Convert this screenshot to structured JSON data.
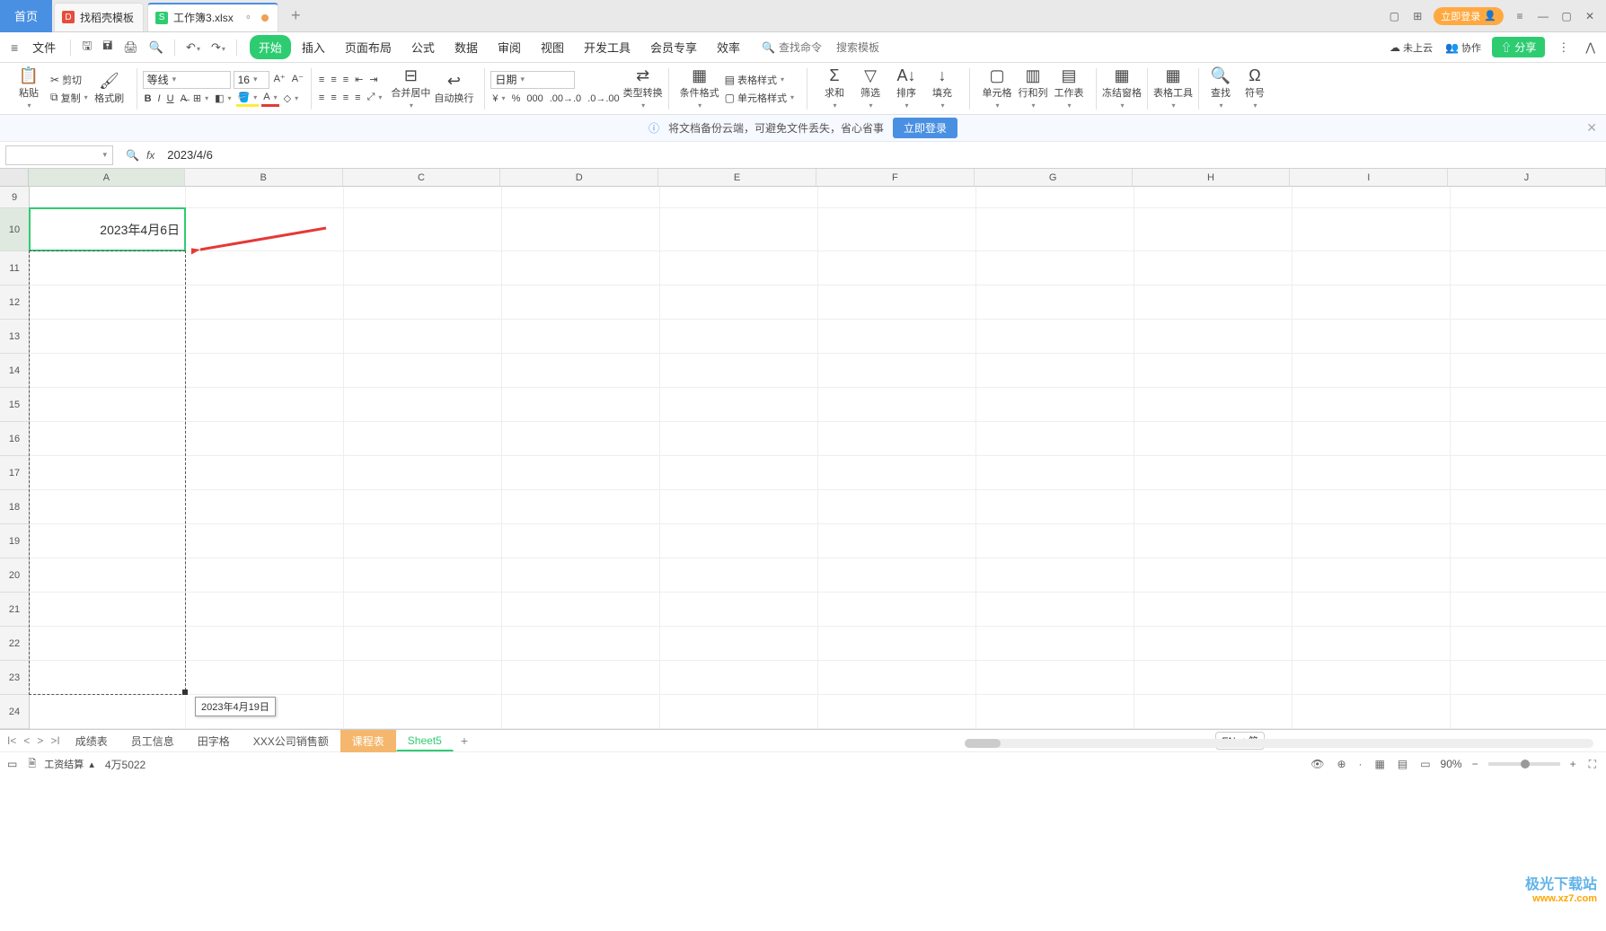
{
  "title_bar": {
    "home_tab": "首页",
    "template_tab": "找稻壳模板",
    "doc_tab": "工作簿3.xlsx",
    "login_btn": "立即登录"
  },
  "menu": {
    "file": "文件",
    "tabs": [
      "开始",
      "插入",
      "页面布局",
      "公式",
      "数据",
      "审阅",
      "视图",
      "开发工具",
      "会员专享",
      "效率"
    ],
    "active_tab": 0,
    "search1_ph": "查找命令",
    "search2_ph": "搜索模板",
    "cloud_a": "未上云",
    "coop": "协作",
    "share": "分享"
  },
  "ribbon": {
    "paste": "粘贴",
    "cut": "剪切",
    "copy": "复制",
    "fmt_painter": "格式刷",
    "font_name": "等线",
    "font_size": "16",
    "merge": "合并居中",
    "wrap": "自动换行",
    "num_fmt": "日期",
    "typeconv": "类型转换",
    "cond_fmt": "条件格式",
    "tbl_style": "表格样式",
    "cell_style": "单元格样式",
    "sum": "求和",
    "filter": "筛选",
    "sort": "排序",
    "fill": "填充",
    "cell": "单元格",
    "rowcol": "行和列",
    "sheet": "工作表",
    "freeze": "冻结窗格",
    "tbl_tools": "表格工具",
    "find": "查找",
    "symbol": "符号"
  },
  "cloud_bar": {
    "msg": "将文档备份云端，可避免文件丢失，省心省事",
    "btn": "立即登录"
  },
  "formula_bar": {
    "name_box": "",
    "fx_label": "fx",
    "value": "2023/4/6"
  },
  "grid": {
    "columns": [
      "A",
      "B",
      "C",
      "D",
      "E",
      "F",
      "G",
      "H",
      "I",
      "J"
    ],
    "rows": [
      9,
      10,
      11,
      12,
      13,
      14,
      15,
      16,
      17,
      18,
      19,
      20,
      21,
      22,
      23,
      24
    ],
    "active_cell_value": "2023年4月6日",
    "drag_tooltip": "2023年4月19日"
  },
  "sheet_tabs": {
    "tabs": [
      "成绩表",
      "员工信息",
      "田字格",
      "XXX公司销售额",
      "课程表",
      "Sheet5"
    ],
    "active": 5,
    "orange": 4,
    "ime": "EN ♫ 简"
  },
  "status": {
    "doc": "工资结算",
    "info": "4万5022",
    "zoom": "90%"
  },
  "watermark": {
    "l1": "极光下载站",
    "l2": "www.xz7.com"
  }
}
